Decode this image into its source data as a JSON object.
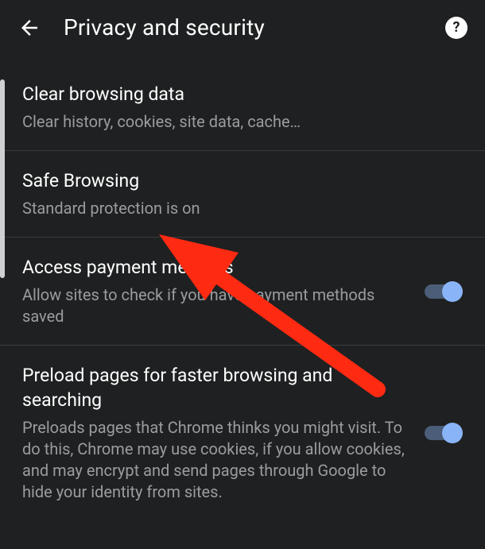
{
  "header": {
    "title": "Privacy and security",
    "back_icon": "back-arrow-icon",
    "help_icon": "help-icon",
    "help_symbol": "?"
  },
  "rows": [
    {
      "title": "Clear browsing data",
      "subtitle": "Clear history, cookies, site data, cache…",
      "has_switch": false
    },
    {
      "title": "Safe Browsing",
      "subtitle": "Standard protection is on",
      "has_switch": false
    },
    {
      "title": "Access payment methods",
      "subtitle": "Allow sites to check if you have payment methods saved",
      "has_switch": true,
      "switch_on": true
    },
    {
      "title": "Preload pages for faster browsing and searching",
      "subtitle": "Preloads pages that Chrome thinks you might visit. To do this, Chrome may use cookies, if you allow cookies, and may encrypt and send pages through Google to hide your identity from sites.",
      "has_switch": true,
      "switch_on": true
    }
  ],
  "annotation": {
    "color": "#ff2a12"
  }
}
